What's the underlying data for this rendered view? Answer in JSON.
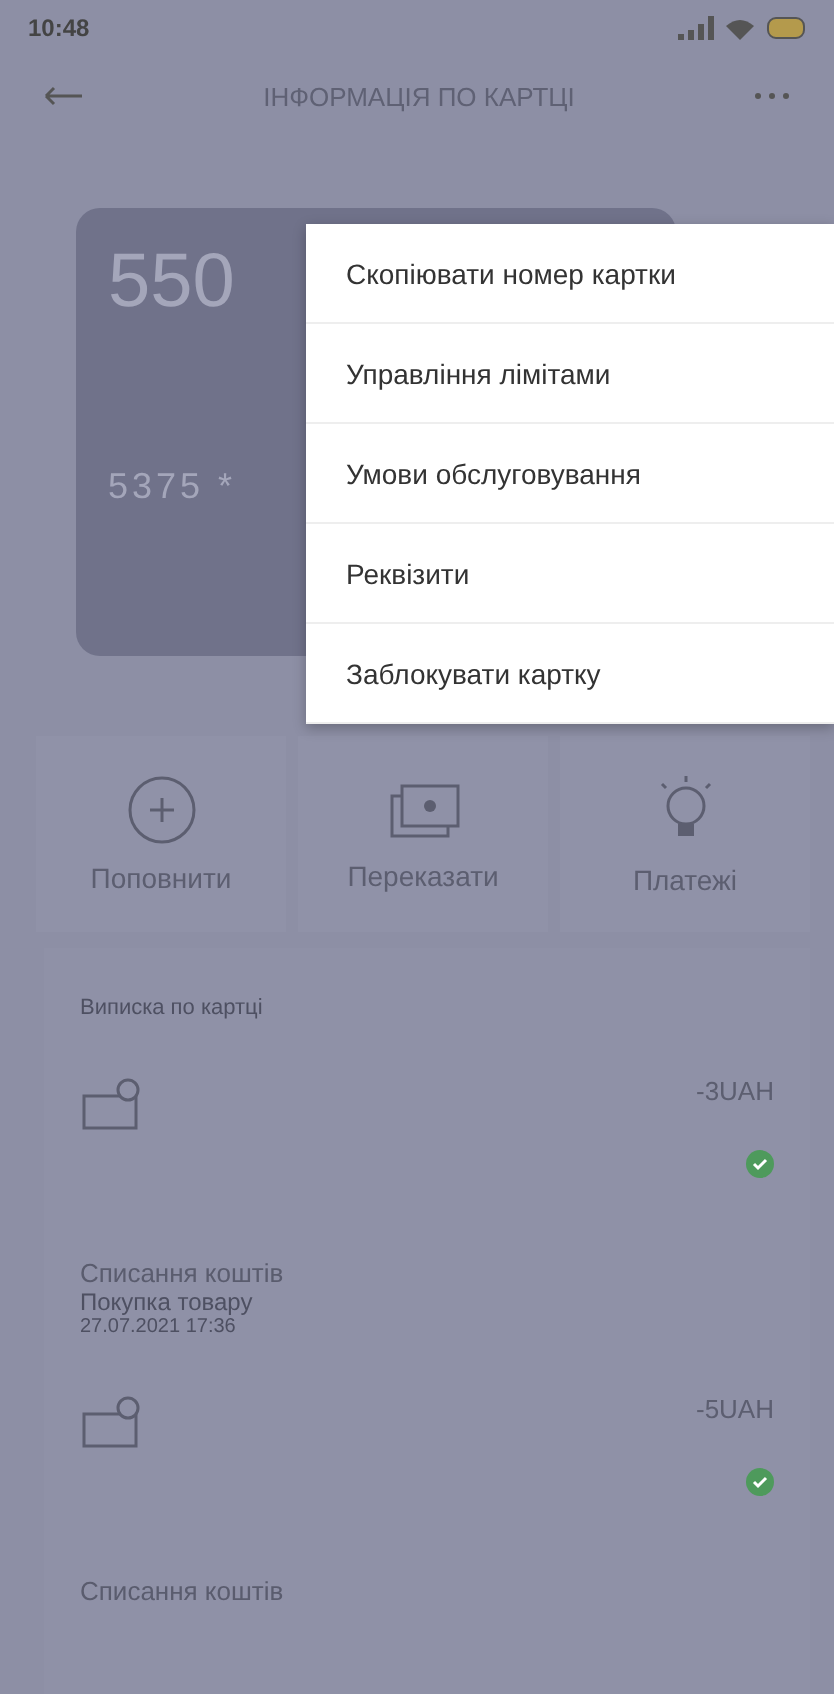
{
  "status_bar": {
    "time": "10:48"
  },
  "header": {
    "title": "ІНФОРМАЦІЯ ПО КАРТЦІ"
  },
  "card": {
    "number_start": "550",
    "number_masked": "5375 *"
  },
  "actions": [
    {
      "kind": "topup",
      "label": "Поповнити"
    },
    {
      "kind": "transfer",
      "label": "Переказати"
    },
    {
      "kind": "payments",
      "label": "Платежі"
    }
  ],
  "statement": {
    "title": "Виписка по картці",
    "transactions": [
      {
        "amount": "-3UAH",
        "title": "Списання коштів",
        "description": "Покупка товару",
        "date": "27.07.2021 17:36"
      },
      {
        "amount": "-5UAH",
        "title": "Списання коштів"
      }
    ]
  },
  "menu": {
    "items": [
      "Скопіювати номер картки",
      "Управління лімітами",
      "Умови обслуговування",
      "Реквізити",
      "Заблокувати картку"
    ]
  }
}
